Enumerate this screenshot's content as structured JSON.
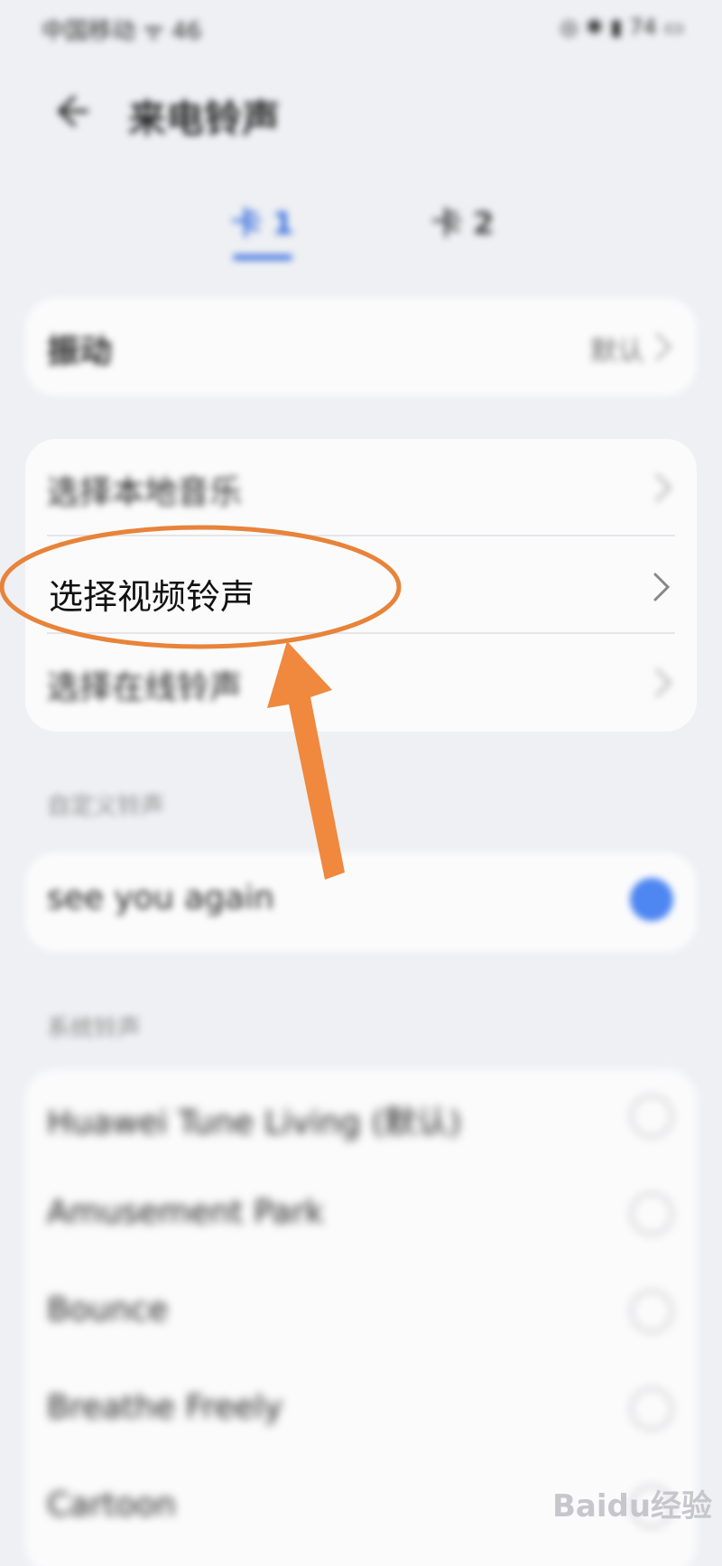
{
  "status_bar": {
    "left_text": "中国移动 ᯤ 46",
    "right_text": "◎ ✱ ▮ 74 ▭"
  },
  "header": {
    "title": "来电铃声"
  },
  "tabs": [
    {
      "label": "卡 1",
      "selected": true
    },
    {
      "label": "卡 2",
      "selected": false
    }
  ],
  "vibrate_card": {
    "label": "振动",
    "value": "默认"
  },
  "source_card": {
    "items": [
      {
        "label": "选择本地音乐"
      },
      {
        "label": "选择视频铃声"
      },
      {
        "label": "选择在线铃声"
      }
    ]
  },
  "custom_section": {
    "label": "自定义铃声",
    "items": [
      {
        "label": "see you again",
        "selected": true
      }
    ]
  },
  "system_section": {
    "label": "系统铃声",
    "items": [
      {
        "label": "Huawei Tune Living (默认)",
        "selected": false
      },
      {
        "label": "Amusement Park",
        "selected": false
      },
      {
        "label": "Bounce",
        "selected": false
      },
      {
        "label": "Breathe Freely",
        "selected": false
      },
      {
        "label": "Cartoon",
        "selected": false
      }
    ]
  },
  "annotation": {
    "highlight_color": "#e8833a",
    "arrow_color": "#f0883e"
  },
  "watermark": {
    "text": "Baidu经验"
  }
}
